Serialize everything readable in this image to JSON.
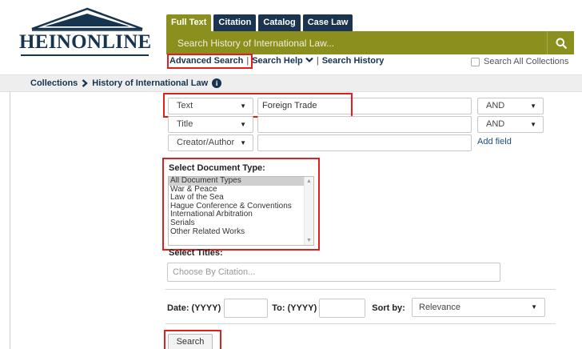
{
  "logo": {
    "text": "HEINONLINE"
  },
  "tabs": [
    {
      "label": "Full Text",
      "active": true
    },
    {
      "label": "Citation",
      "active": false
    },
    {
      "label": "Catalog",
      "active": false
    },
    {
      "label": "Case Law",
      "active": false
    }
  ],
  "search": {
    "placeholder": "Search History of International Law...",
    "button_icon": "search-icon"
  },
  "links": {
    "advanced": "Advanced Search",
    "help": "Search Help",
    "history": "Search History",
    "separator": "|"
  },
  "search_all": {
    "label": "Search All Collections",
    "checked": false
  },
  "breadcrumb": {
    "root": "Collections",
    "current": "History of International Law"
  },
  "fields": [
    {
      "field": "Text",
      "value": "Foreign Trade",
      "operator": "AND"
    },
    {
      "field": "Title",
      "value": "",
      "operator": "AND"
    },
    {
      "field": "Creator/Author",
      "value": ""
    }
  ],
  "add_field": "Add field",
  "document_type": {
    "label": "Select Document Type:",
    "options": [
      "All Document Types",
      "War & Peace",
      "Law of the Sea",
      "Hague Conference & Conventions",
      "International Arbitration",
      "Serials",
      "Other Related Works"
    ],
    "selected": "All Document Types"
  },
  "titles": {
    "label": "Select Titles:",
    "placeholder": "Choose By Citation..."
  },
  "date": {
    "from_label": "Date: (YYYY)",
    "to_label": "To: (YYYY)",
    "sort_label": "Sort by:",
    "sort_value": "Relevance"
  },
  "submit": {
    "label": "Search"
  },
  "colors": {
    "navy": "#16334f",
    "olive": "#8a8f1e",
    "highlight": "#e02020"
  }
}
